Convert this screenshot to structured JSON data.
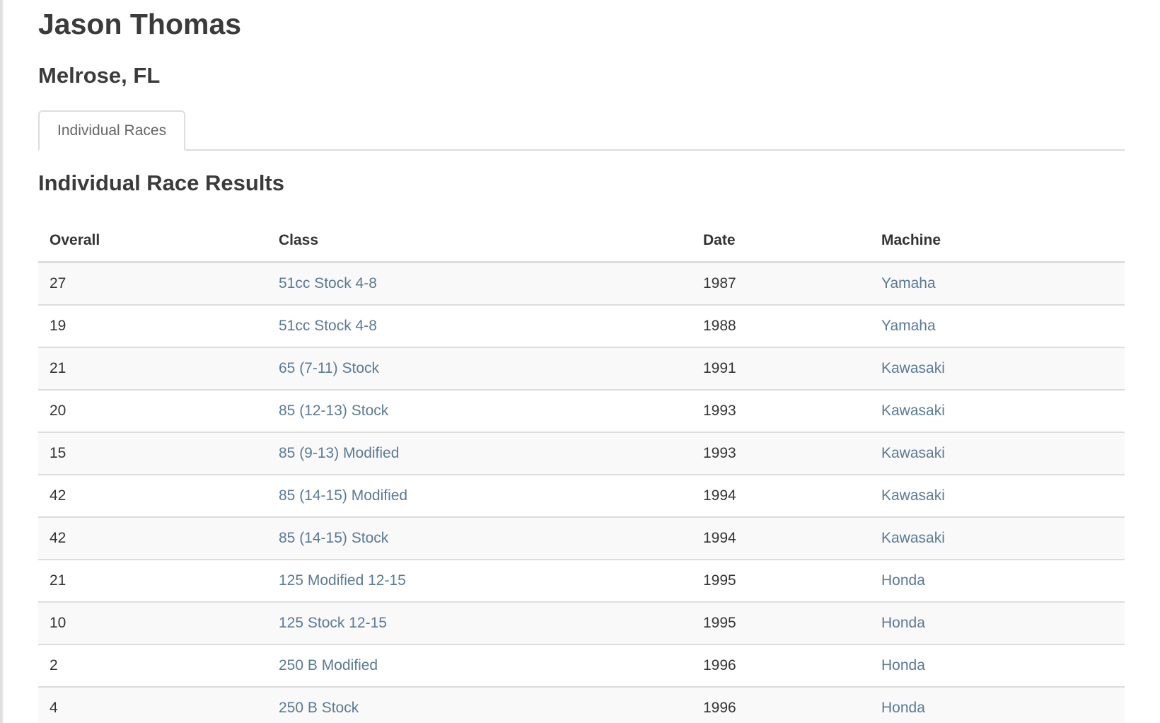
{
  "rider": {
    "name": "Jason Thomas",
    "location": "Melrose, FL"
  },
  "tabs": [
    {
      "label": "Individual Races",
      "active": true
    }
  ],
  "section": {
    "title": "Individual Race Results"
  },
  "table": {
    "columns": [
      "Overall",
      "Class",
      "Date",
      "Machine"
    ],
    "rows": [
      {
        "overall": "27",
        "class": "51cc Stock 4-8",
        "date": "1987",
        "machine": "Yamaha"
      },
      {
        "overall": "19",
        "class": "51cc Stock 4-8",
        "date": "1988",
        "machine": "Yamaha"
      },
      {
        "overall": "21",
        "class": "65 (7-11) Stock",
        "date": "1991",
        "machine": "Kawasaki"
      },
      {
        "overall": "20",
        "class": "85 (12-13) Stock",
        "date": "1993",
        "machine": "Kawasaki"
      },
      {
        "overall": "15",
        "class": "85 (9-13) Modified",
        "date": "1993",
        "machine": "Kawasaki"
      },
      {
        "overall": "42",
        "class": "85 (14-15) Modified",
        "date": "1994",
        "machine": "Kawasaki"
      },
      {
        "overall": "42",
        "class": "85 (14-15) Stock",
        "date": "1994",
        "machine": "Kawasaki"
      },
      {
        "overall": "21",
        "class": "125 Modified 12-15",
        "date": "1995",
        "machine": "Honda"
      },
      {
        "overall": "10",
        "class": "125 Stock 12-15",
        "date": "1995",
        "machine": "Honda"
      },
      {
        "overall": "2",
        "class": "250 B Modified",
        "date": "1996",
        "machine": "Honda"
      },
      {
        "overall": "4",
        "class": "250 B Stock",
        "date": "1996",
        "machine": "Honda"
      }
    ]
  },
  "colors": {
    "link": "#5a7a96",
    "heading": "#3b3b3b",
    "border": "#dddddd",
    "stripe": "#f9f9f9"
  }
}
